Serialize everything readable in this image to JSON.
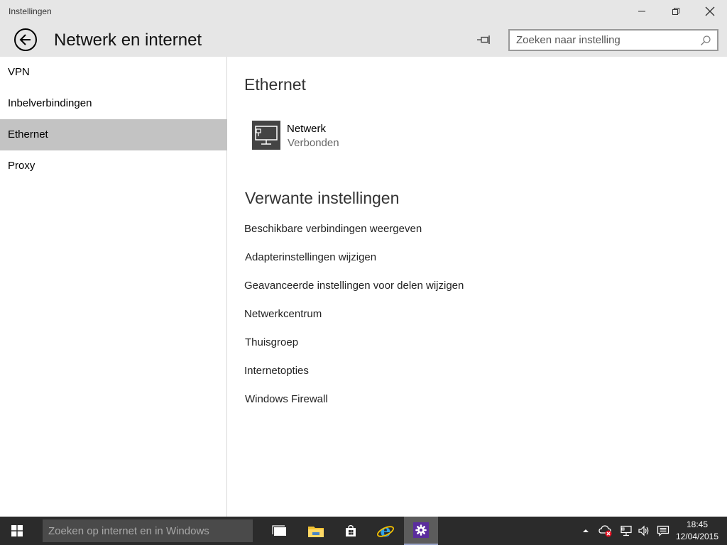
{
  "window": {
    "app_title": "Instellingen"
  },
  "header": {
    "page_title": "Netwerk en internet",
    "search_placeholder": "Zoeken naar instelling"
  },
  "sidebar": {
    "items": [
      {
        "label": "VPN",
        "selected": false
      },
      {
        "label": "Inbelverbindingen",
        "selected": false
      },
      {
        "label": "Ethernet",
        "selected": true
      },
      {
        "label": "Proxy",
        "selected": false
      }
    ]
  },
  "main": {
    "section_title": "Ethernet",
    "network": {
      "name": "Netwerk",
      "status": "Verbonden",
      "icon": "ethernet-monitor-icon"
    },
    "related_title": "Verwante instellingen",
    "related_links": [
      "Beschikbare verbindingen weergeven",
      "Adapterinstellingen wijzigen",
      "Geavanceerde instellingen voor delen wijzigen",
      "Netwerkcentrum",
      "Thuisgroep",
      "Internetopties",
      "Windows Firewall"
    ]
  },
  "taskbar": {
    "search_placeholder": "Zoeken op internet en in Windows",
    "apps": [
      "task-view-icon",
      "file-explorer-icon",
      "store-icon",
      "internet-explorer-icon",
      "settings-gear-icon"
    ],
    "clock_time": "18:45",
    "clock_date": "12/04/2015"
  },
  "colors": {
    "chrome": "#e6e6e6",
    "selected": "#c3c3c3",
    "taskbar": "#2b2b2b",
    "accent": "#5b2d9e"
  }
}
